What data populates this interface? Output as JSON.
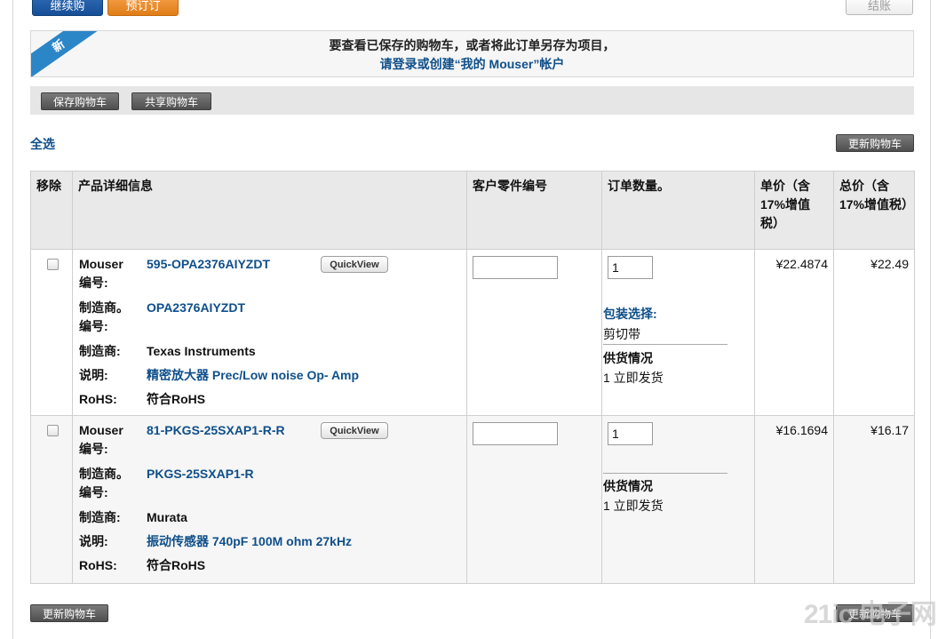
{
  "top_buttons": {
    "continue_shopping": "继续购物",
    "pre_order": "预订订单",
    "checkout": "结账"
  },
  "notice": {
    "badge": "新",
    "line1": "要查看已保存的购物车，或者将此订单另存为项目，",
    "line2": "请登录或创建“我的 Mouser”帐户"
  },
  "toolbar": {
    "save_cart": "保存购物车",
    "share_cart": "共享购物车"
  },
  "select_all": "全选",
  "update_cart": "更新购物车",
  "table": {
    "headers": {
      "remove": "移除",
      "details": "产品详细信息",
      "customer_part": "客户零件编号",
      "order_qty": "订单数量。",
      "unit_price": "单价（含17%增值税）",
      "total_price": "总价（含17%增值税）"
    },
    "labels": {
      "mouser_no": "Mouser编号:",
      "mfr_no": "制造商。编号:",
      "manufacturer": "制造商:",
      "description": "说明:",
      "rohs": "RoHS:",
      "quickview": "QuickView",
      "packaging": "包装选择:",
      "availability": "供货情况"
    },
    "rows": [
      {
        "mouser_no": "595-OPA2376AIYZDT",
        "mfr_no": "OPA2376AIYZDT",
        "manufacturer": "Texas Instruments",
        "description": "精密放大器 Prec/Low noise Op- Amp",
        "rohs": "符合RoHS",
        "qty": "1",
        "packaging": "剪切带",
        "availability": "1 立即发货",
        "unit_price": "¥22.4874",
        "total_price": "¥22.49"
      },
      {
        "mouser_no": "81-PKGS-25SXAP1-R-R",
        "mfr_no": "PKGS-25SXAP1-R",
        "manufacturer": "Murata",
        "description": "振动传感器 740pF 100M ohm 27kHz",
        "rohs": "符合RoHS",
        "qty": "1",
        "availability": "1 立即发货",
        "unit_price": "¥16.1694",
        "total_price": "¥16.17"
      }
    ]
  },
  "watermark": "21ic 电子网"
}
